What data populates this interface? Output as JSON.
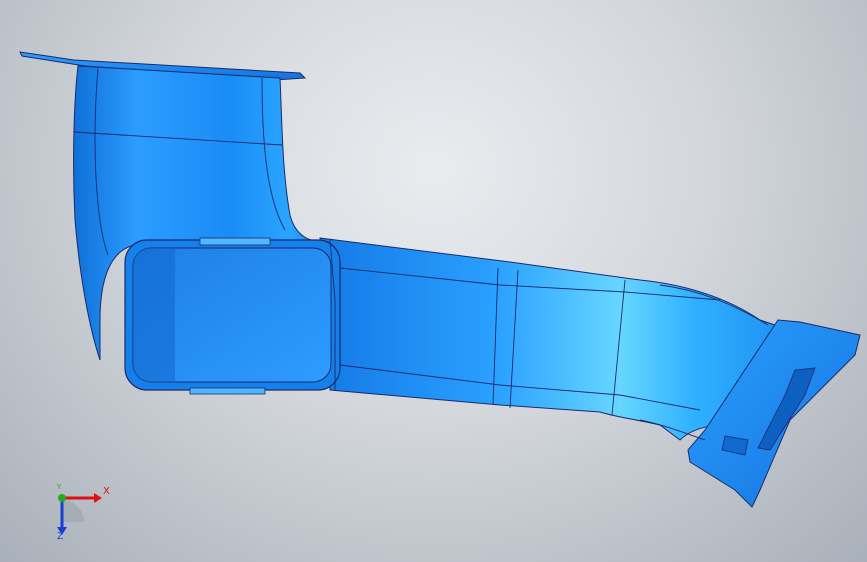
{
  "viewport": {
    "background_colors": [
      "#e9ecef",
      "#a9b0b9"
    ]
  },
  "model": {
    "part_color": "#1e90ff",
    "highlight_color": "#7fe0ff",
    "edge_color": "#1b2a6b"
  },
  "triad": {
    "x_label": "X",
    "y_label": "Y",
    "z_label": "Z",
    "x_color": "#dd1111",
    "y_color": "#22aa22",
    "z_color": "#1a3fcf"
  }
}
